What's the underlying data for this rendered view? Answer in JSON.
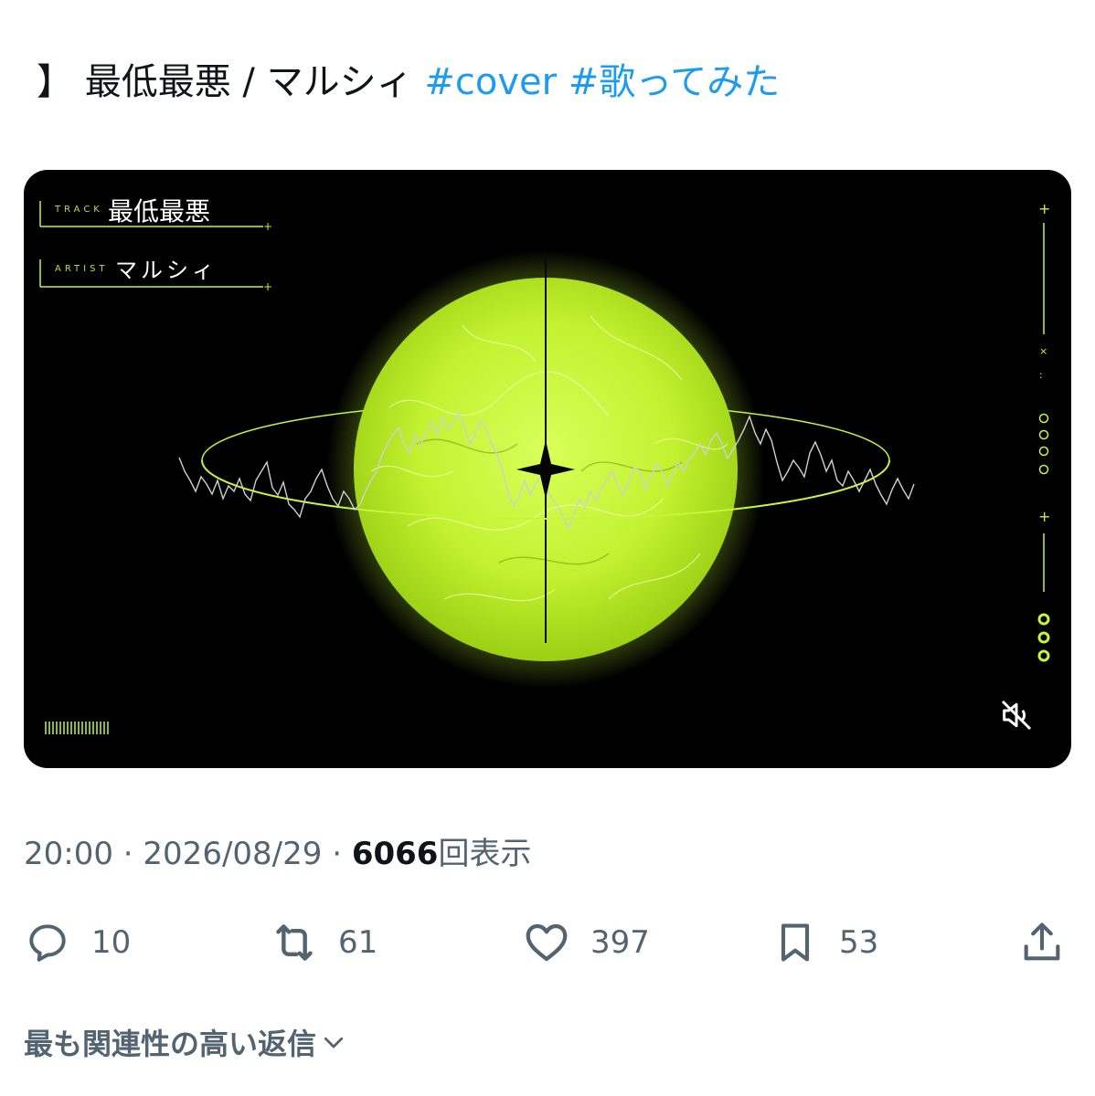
{
  "tweet": {
    "text_prefix": "】 最低最悪 / マルシィ",
    "hashtags": [
      "#cover",
      "#歌ってみた"
    ]
  },
  "media": {
    "track_label": "TRACK",
    "track_title": "最低最悪",
    "artist_label": "ARTIST",
    "artist_name": "マルシィ",
    "accent_color": "#c6f53a",
    "mute_icon": "speaker-muted-icon"
  },
  "meta": {
    "time": "20:00",
    "separator": " · ",
    "date": "2026/08/29",
    "views": "6066",
    "views_suffix": "回表示"
  },
  "actions": {
    "reply": {
      "icon": "reply-icon",
      "count": "10"
    },
    "retweet": {
      "icon": "retweet-icon",
      "count": "61"
    },
    "like": {
      "icon": "heart-icon",
      "count": "397"
    },
    "bookmark": {
      "icon": "bookmark-icon",
      "count": "53"
    },
    "share": {
      "icon": "share-icon"
    }
  },
  "replies_sort": {
    "label": "最も関連性の高い返信",
    "icon": "chevron-down-icon"
  },
  "colors": {
    "link": "#1d9bf0",
    "secondary_text": "#536471",
    "primary_text": "#0f1419"
  }
}
